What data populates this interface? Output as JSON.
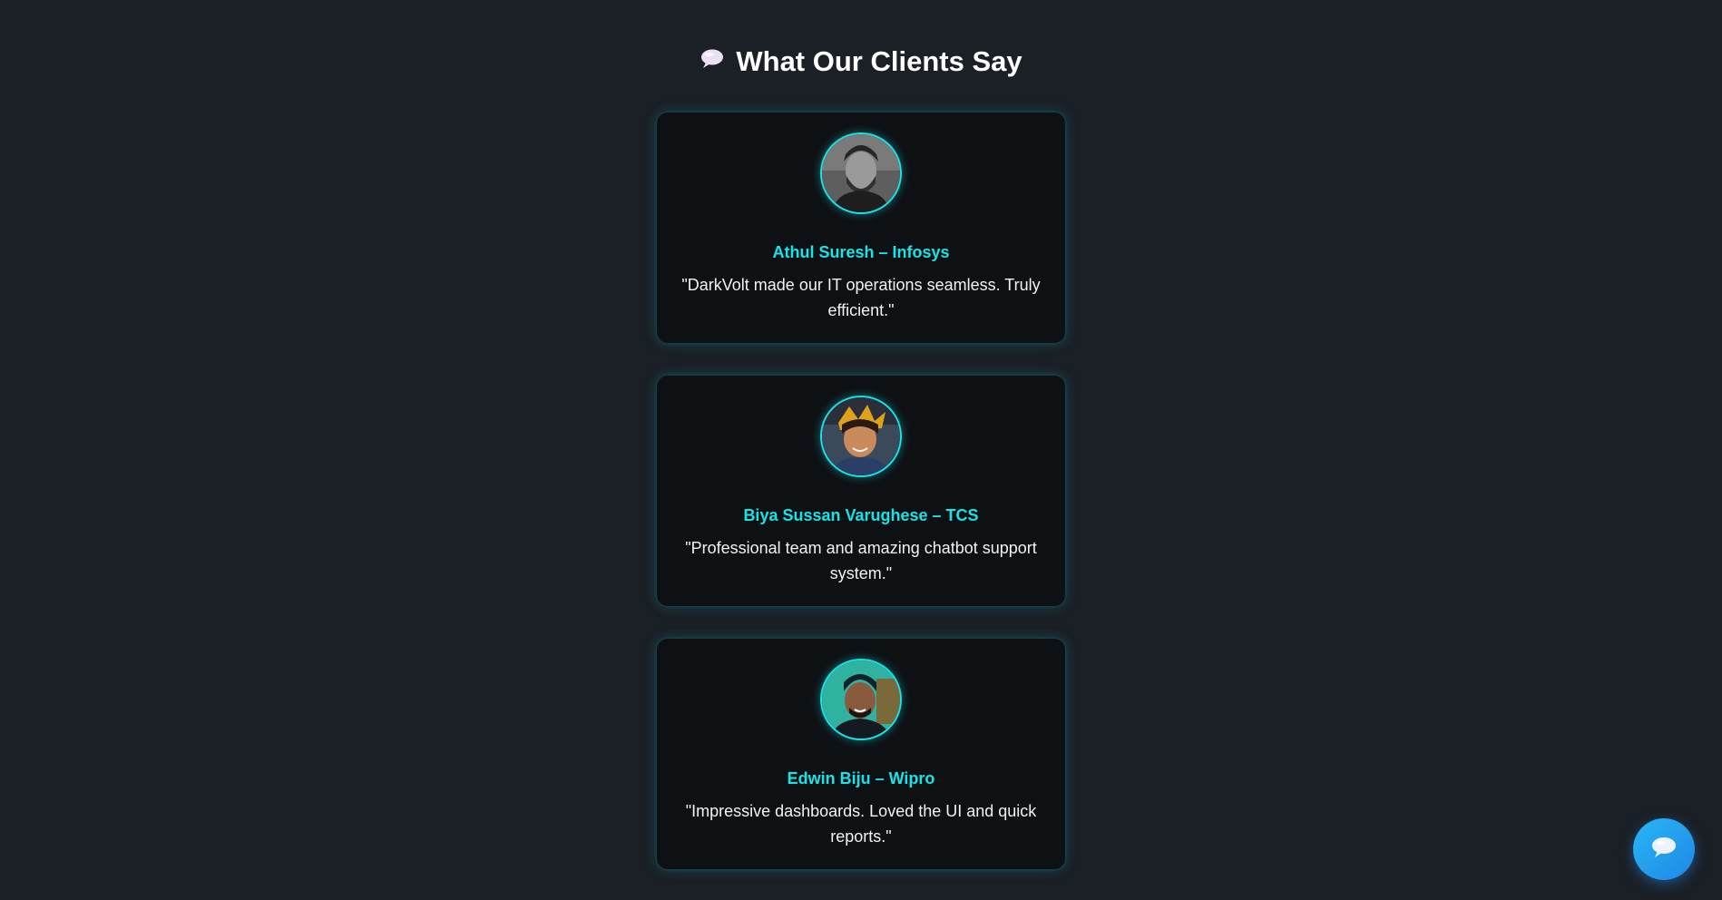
{
  "testimonials": {
    "title": "What Our Clients Say",
    "title_icon": "speech-bubble-icon",
    "items": [
      {
        "name": "Athul Suresh – Infosys",
        "quote": "\"DarkVolt made our IT operations seamless. Truly efficient.\"",
        "avatar_icon": "avatar-photo"
      },
      {
        "name": "Biya Sussan Varughese – TCS",
        "quote": "\"Professional team and amazing chatbot support system.\"",
        "avatar_icon": "avatar-photo"
      },
      {
        "name": "Edwin Biju – Wipro",
        "quote": "\"Impressive dashboards. Loved the UI and quick reports.\"",
        "avatar_icon": "avatar-photo"
      }
    ]
  },
  "chat_button": {
    "icon": "chat-bubble-icon"
  },
  "colors": {
    "background": "#1b1f26",
    "card": "#0e1114",
    "accent": "#19e3e6",
    "fab": "#1e88e5"
  }
}
